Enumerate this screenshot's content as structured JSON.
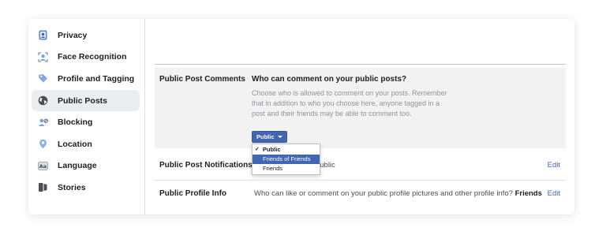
{
  "sidebar": {
    "items": [
      {
        "label": "Privacy",
        "icon": "privacy-lock-icon",
        "active": false
      },
      {
        "label": "Face Recognition",
        "icon": "face-recognition-icon",
        "active": false
      },
      {
        "label": "Profile and Tagging",
        "icon": "tag-icon",
        "active": false
      },
      {
        "label": "Public Posts",
        "icon": "globe-icon",
        "active": true
      },
      {
        "label": "Blocking",
        "icon": "block-user-icon",
        "active": false
      },
      {
        "label": "Location",
        "icon": "location-pin-icon",
        "active": false
      },
      {
        "label": "Language",
        "icon": "language-icon",
        "active": false
      },
      {
        "label": "Stories",
        "icon": "stories-icon",
        "active": false
      }
    ]
  },
  "public_post_comments": {
    "label": "Public Post Comments",
    "question": "Who can comment on your public posts?",
    "description": "Choose who is allowed to comment on your posts. Remember that in addition to who you choose here, anyone tagged in a post and their friends may be able to comment too.",
    "dropdown": {
      "selected": "Public",
      "options": [
        {
          "label": "Public",
          "checked": true,
          "highlighted": false
        },
        {
          "label": "Friends of Friends",
          "checked": false,
          "highlighted": true
        },
        {
          "label": "Friends",
          "checked": false,
          "highlighted": false
        }
      ]
    }
  },
  "public_post_notifications": {
    "label": "Public Post Notifications",
    "value": "n Public",
    "edit": "Edit"
  },
  "public_profile_info": {
    "label": "Public Profile Info",
    "value_prefix": "Who can like or comment on your public profile pictures and other profile info?",
    "value_strong": "Friends",
    "edit": "Edit"
  },
  "colors": {
    "accent": "#4267b2",
    "panel_bg": "#f2f2f3",
    "muted_text": "#90949c"
  }
}
